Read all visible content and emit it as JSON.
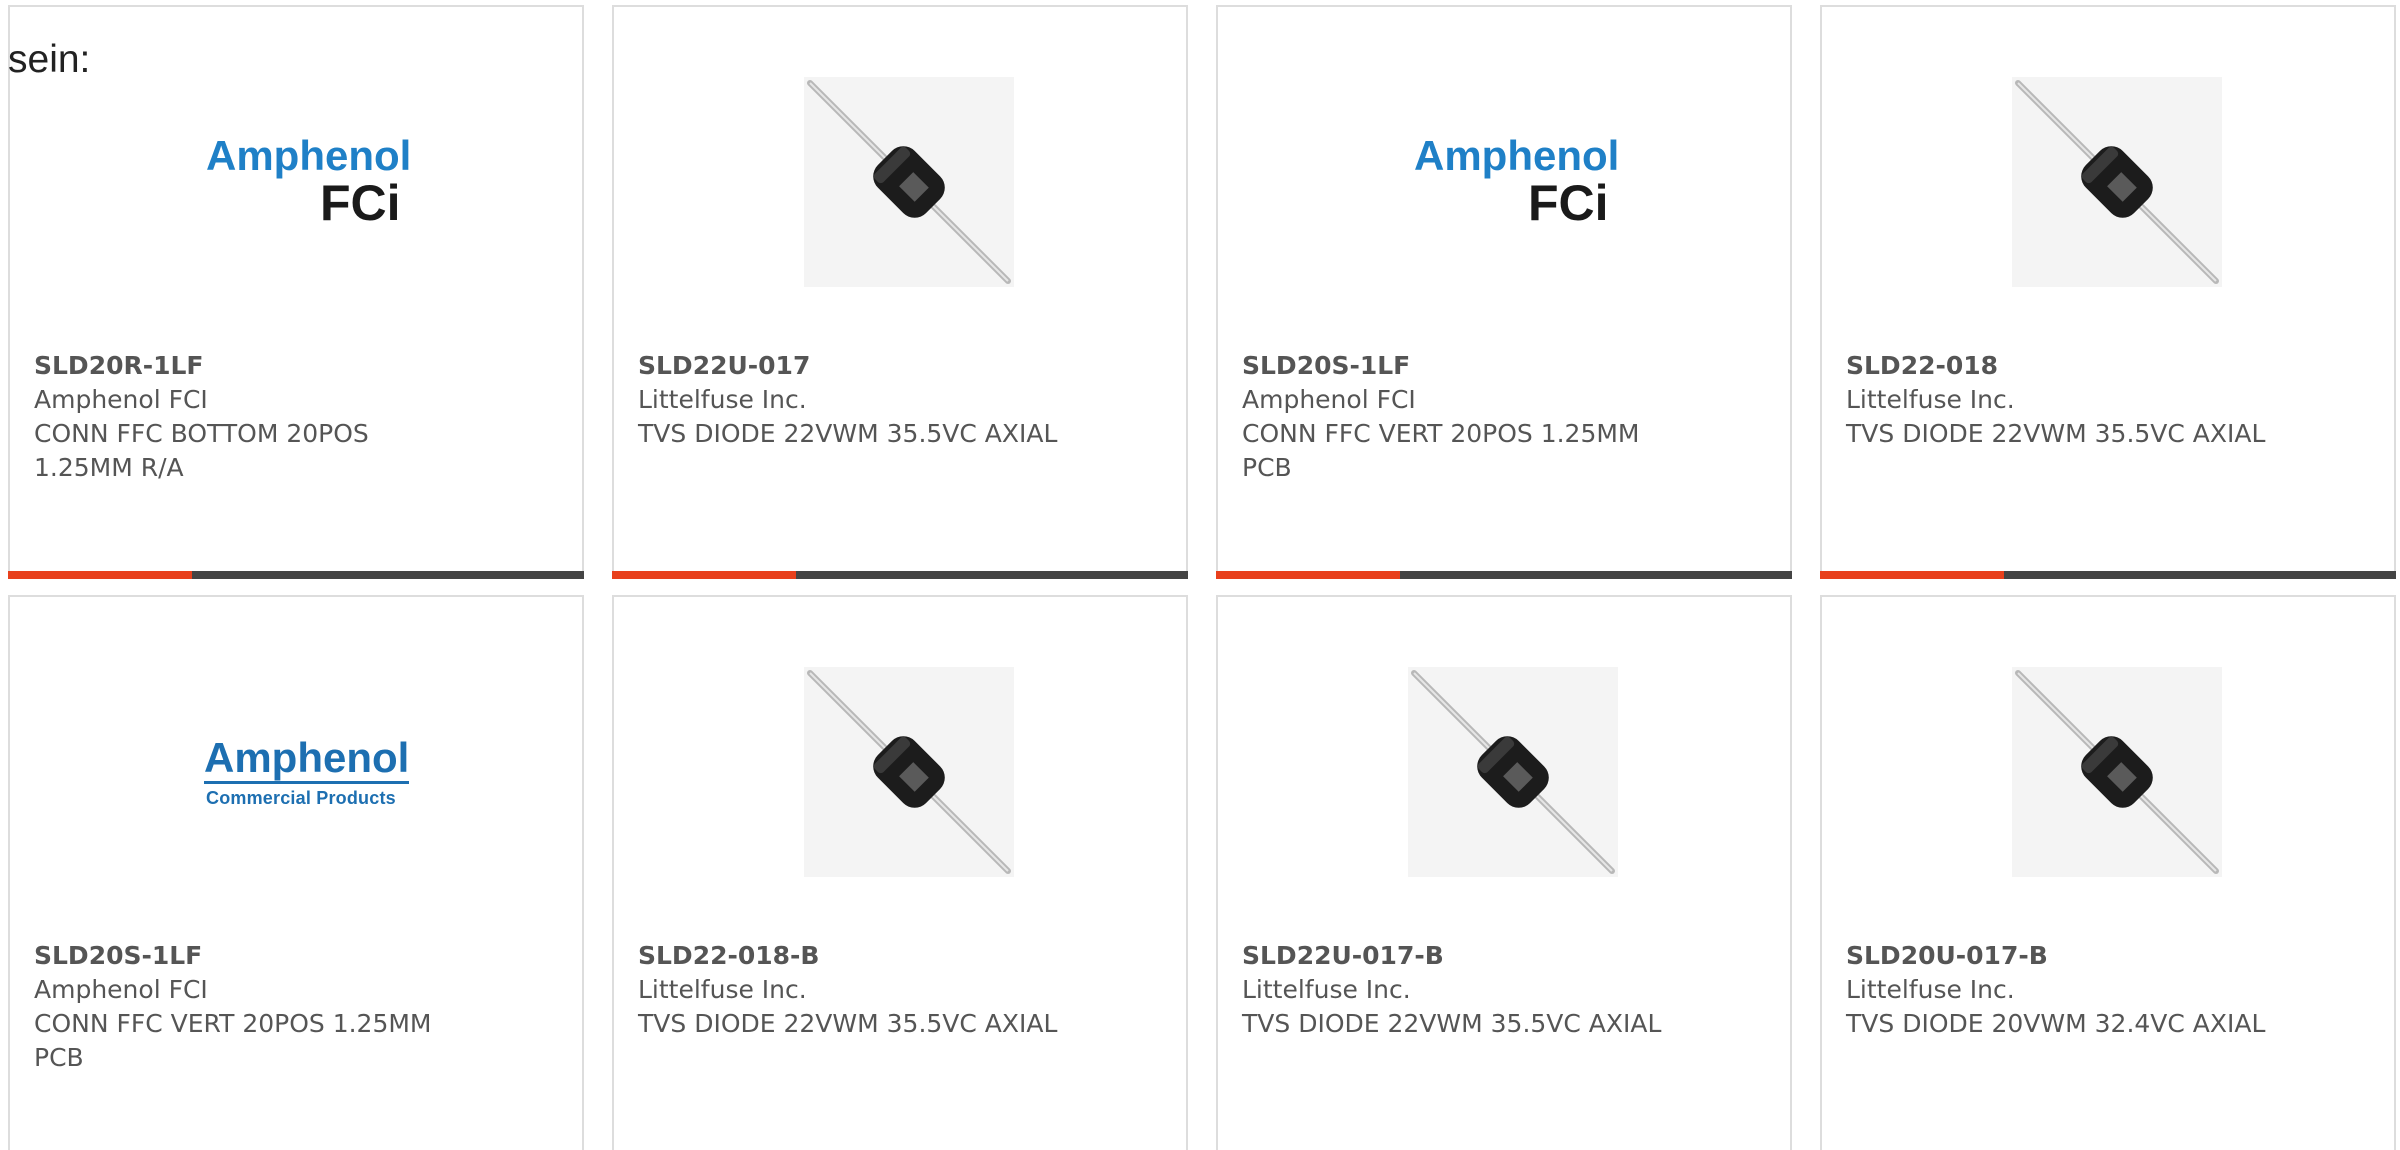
{
  "intro_text": "sein:",
  "colors": {
    "accent": "#e8401c",
    "bar": "#444444",
    "border": "#dddddd",
    "text": "#555555"
  },
  "products": [
    {
      "part_number": "SLD20R-1LF",
      "manufacturer": "Amphenol FCI",
      "description": "CONN FFC BOTTOM 20POS 1.25MM R/A",
      "image": "amphenol-fci-logo",
      "logo_text": [
        "Amphenol",
        "FCi"
      ]
    },
    {
      "part_number": "SLD22U-017",
      "manufacturer": "Littelfuse Inc.",
      "description": "TVS DIODE 22VWM 35.5VC AXIAL",
      "image": "axial-diode-photo"
    },
    {
      "part_number": "SLD20S-1LF",
      "manufacturer": "Amphenol FCI",
      "description": "CONN FFC VERT 20POS 1.25MM PCB",
      "image": "amphenol-fci-logo",
      "logo_text": [
        "Amphenol",
        "FCi"
      ]
    },
    {
      "part_number": "SLD22-018",
      "manufacturer": "Littelfuse Inc.",
      "description": "TVS DIODE 22VWM 35.5VC AXIAL",
      "image": "axial-diode-photo"
    },
    {
      "part_number": "SLD20S-1LF",
      "manufacturer": "Amphenol FCI",
      "description": "CONN FFC VERT 20POS 1.25MM PCB",
      "image": "amphenol-commercial-products-logo",
      "logo_text": [
        "Amphenol",
        "Commercial Products"
      ]
    },
    {
      "part_number": "SLD22-018-B",
      "manufacturer": "Littelfuse Inc.",
      "description": "TVS DIODE 22VWM 35.5VC AXIAL",
      "image": "axial-diode-photo"
    },
    {
      "part_number": "SLD22U-017-B",
      "manufacturer": "Littelfuse Inc.",
      "description": "TVS DIODE 22VWM 35.5VC AXIAL",
      "image": "axial-diode-photo"
    },
    {
      "part_number": "SLD20U-017-B",
      "manufacturer": "Littelfuse Inc.",
      "description": "TVS DIODE 20VWM 32.4VC AXIAL",
      "image": "axial-diode-photo"
    }
  ]
}
